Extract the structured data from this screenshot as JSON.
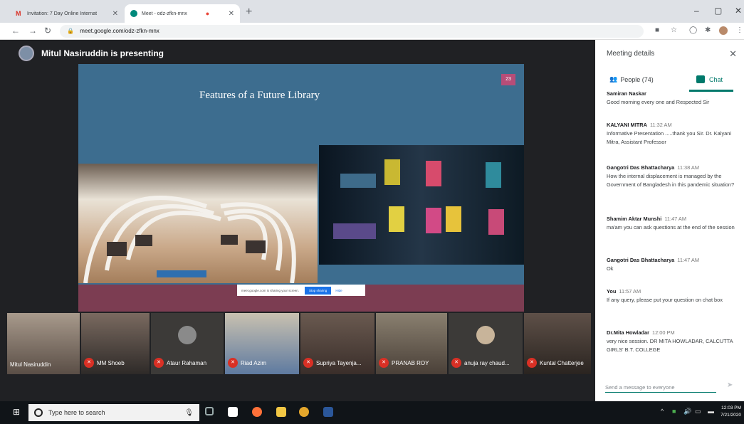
{
  "browser": {
    "tabs": [
      {
        "label": "Invitation: 7 Day Online Internat",
        "icon": "gmail-icon"
      },
      {
        "label": "Meet - odz-zfkn-mnx",
        "icon": "meet-icon",
        "recording_dot": "●"
      }
    ],
    "url": "meet.google.com/odz-zfkn-mnx"
  },
  "meeting": {
    "presenter_text": "Mitul Nasiruddin is presenting",
    "slide": {
      "title": "Features of a Future Library",
      "number": "23",
      "share_notice": "meet.google.com is sharing your screen.",
      "stop_label": "Stop sharing",
      "hide_label": "Hide"
    },
    "participants": [
      {
        "name": "Mitul Nasiruddin",
        "muted": false
      },
      {
        "name": "MM Shoeb",
        "muted": true
      },
      {
        "name": "Ataur Rahaman",
        "muted": true
      },
      {
        "name": "Riad Azim",
        "muted": true
      },
      {
        "name": "Supriya Tayenja...",
        "muted": true
      },
      {
        "name": "PRANAB ROY",
        "muted": true
      },
      {
        "name": "anuja ray chaud...",
        "muted": true
      },
      {
        "name": "Kuntal Chatterjee",
        "muted": true
      }
    ]
  },
  "panel": {
    "title": "Meeting details",
    "people_tab": "People (74)",
    "chat_tab": "Chat",
    "messages": [
      {
        "sender": "Samiran Naskar",
        "time": "",
        "text": "Good morning every one and Respected Sir"
      },
      {
        "sender": "KALYANI MITRA",
        "time": "11:32 AM",
        "text": "Informative Presentation .....thank you Sir. Dr. Kalyani Mitra, Assistant Professor"
      },
      {
        "sender": "Gangotri Das Bhattacharya",
        "time": "11:38 AM",
        "text": "How the internal displacement is managed by the Government of Bangladesh in this pandemic situation?"
      },
      {
        "sender": "Shamim Aktar Munshi",
        "time": "11:47 AM",
        "text": "ma'am you can ask questions at the end of the session"
      },
      {
        "sender": "Gangotri Das Bhattacharya",
        "time": "11:47 AM",
        "text": "Ok"
      },
      {
        "sender": "You",
        "time": "11:57 AM",
        "text": "If any query, please put your question on chat box"
      },
      {
        "sender": "Dr.Mita Howladar",
        "time": "12:00 PM",
        "text": "very nice session. DR MITA HOWLADAR, CALCUTTA GIRLS' B.T. COLLEGE"
      }
    ],
    "input_placeholder": "Send a message to everyone"
  },
  "taskbar": {
    "search_placeholder": "Type here to search",
    "time": "12:03 PM",
    "date": "7/21/2020"
  },
  "colors": {
    "chat_accent": "#00796b",
    "mic_muted": "#d93025",
    "slide_bg": "#3d6d8f",
    "slide_band": "#7c3d52"
  }
}
